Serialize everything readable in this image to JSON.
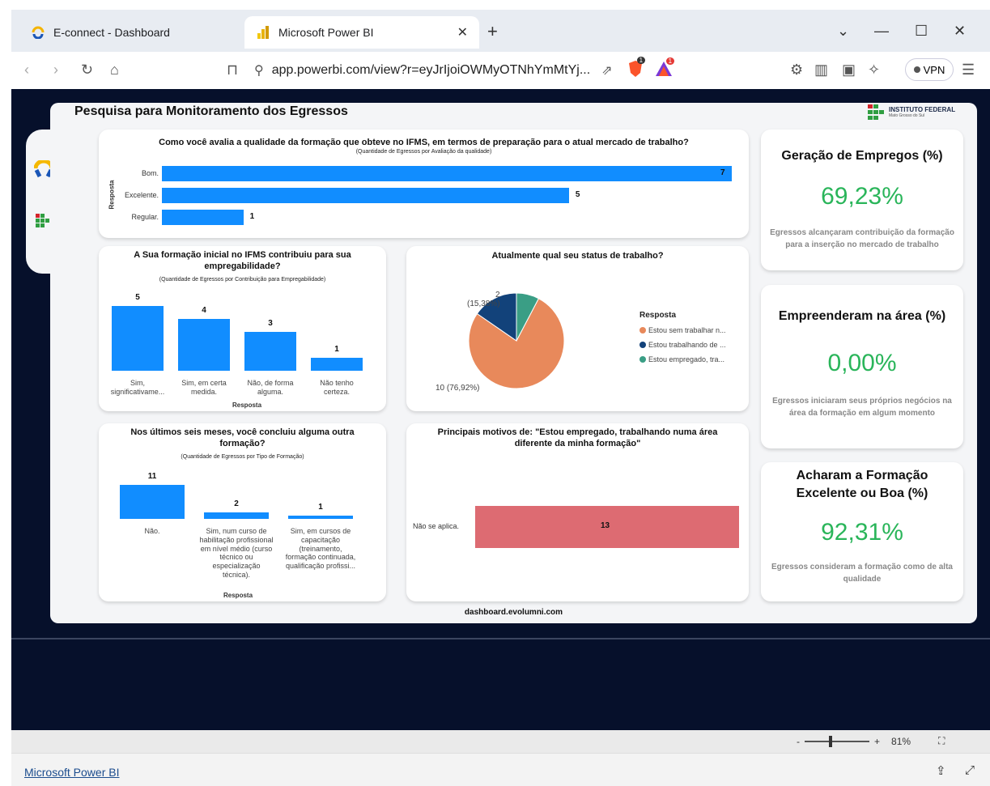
{
  "browser": {
    "tabs": [
      {
        "label": "E-connect - Dashboard",
        "icon": "econnect-icon"
      },
      {
        "label": "Microsoft Power BI",
        "icon": "powerbi-icon",
        "active": true
      }
    ],
    "url": "app.powerbi.com/view?r=eyJrIjoiOWMyOTNhYmMtYj...",
    "vpn_label": "VPN",
    "shield_badge": "1",
    "brave_badge": "1"
  },
  "report": {
    "title": "Pesquisa para Monitoramento dos Egressos",
    "brand_name": "INSTITUTO FEDERAL",
    "brand_sub": "Mato Grosso do Sul",
    "footer": "dashboard.evolumni.com"
  },
  "quality_chart": {
    "title": "Como você avalia a qualidade da formação que obteve no IFMS, em termos de preparação para o atual mercado de trabalho?",
    "subtitle": "(Quantidade de Egressos por Avaliação da qualidade)",
    "ylabel": "Resposta"
  },
  "employability_chart": {
    "title": "A Sua formação inicial no IFMS contribuiu para sua empregabilidade?",
    "subtitle": "(Quantidade de Egressos por Contribuição para Empregabilidade)",
    "xlabel": "Resposta"
  },
  "status_chart": {
    "title": "Atualmente qual seu status de trabalho?",
    "legend_title": "Resposta",
    "label_small": "2",
    "label_small_pct": "(15,38%)",
    "label_large": "10 (76,92%)"
  },
  "other_course_chart": {
    "title": "Nos últimos seis meses, você concluiu alguma outra formação?",
    "subtitle": "(Quantidade de Egressos por Tipo de Formação)",
    "xlabel": "Resposta"
  },
  "reasons_chart": {
    "title": "Principais motivos de: \"Estou empregado, trabalhando numa área diferente da minha formação\""
  },
  "kpis": [
    {
      "title": "Geração de Empregos (%)",
      "value": "69,23%",
      "desc": "Egressos  alcançaram contribuição da formação para a inserção no mercado de trabalho"
    },
    {
      "title": "Empreenderam na área (%)",
      "value": "0,00%",
      "desc": "Egressos iniciaram seus próprios negócios na área da formação em algum momento"
    },
    {
      "title": "Acharam a Formação Excelente ou Boa  (%)",
      "value": "92,31%",
      "desc": "Egressos consideram a formação como de alta qualidade"
    }
  ],
  "statusbar": {
    "zoom": "81%",
    "minus": "-",
    "plus": "+"
  },
  "bottom": {
    "link": "Microsoft Power BI"
  },
  "colors": {
    "bar": "#118dff",
    "pie_orange": "#e8895b",
    "pie_navy": "#12427a",
    "pie_teal": "#3a9e85",
    "reason_bar": "#dd6b72",
    "kpi_green": "#2ab55a"
  },
  "chart_data": [
    {
      "type": "bar",
      "orientation": "horizontal",
      "categories": [
        "Bom.",
        "Excelente.",
        "Regular."
      ],
      "values": [
        7,
        5,
        1
      ],
      "xlim": [
        0,
        7
      ]
    },
    {
      "type": "bar",
      "categories": [
        "Sim, significativame...",
        "Sim, em certa medida.",
        "Não, de forma alguma.",
        "Não tenho certeza."
      ],
      "values": [
        5,
        4,
        3,
        1
      ],
      "ylim": [
        0,
        5
      ]
    },
    {
      "type": "pie",
      "categories": [
        "Estou sem trabalhar n...",
        "Estou trabalhando de ...",
        "Estou empregado, tra..."
      ],
      "values": [
        10,
        2,
        1
      ]
    },
    {
      "type": "bar",
      "categories": [
        "Não.",
        "Sim, num curso de habilitação profissional em nível médio (curso técnico ou especialização técnica).",
        "Sim, em cursos de capacitação (treinamento, formação continuada, qualificação profissi..."
      ],
      "values": [
        11,
        2,
        1
      ],
      "ylim": [
        0,
        11
      ]
    },
    {
      "type": "bar",
      "orientation": "horizontal",
      "categories": [
        "Não se aplica."
      ],
      "values": [
        13
      ]
    }
  ]
}
